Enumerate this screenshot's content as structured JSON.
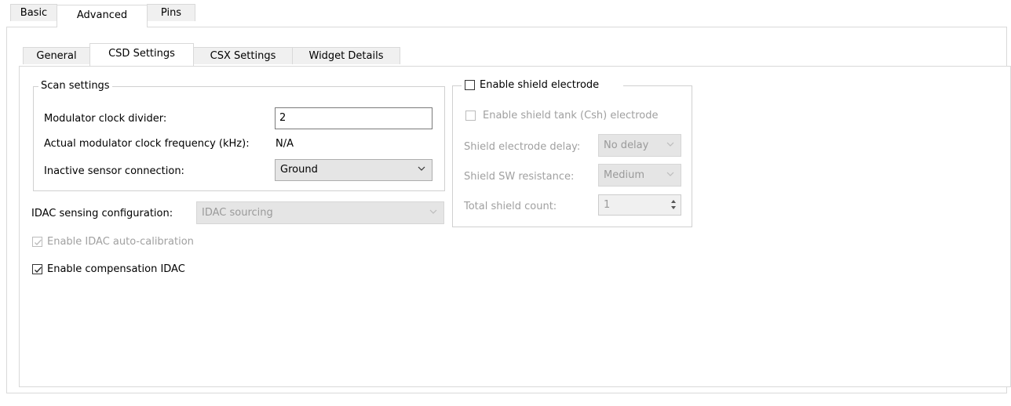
{
  "top_tabs": [
    {
      "label": "Basic",
      "active": false
    },
    {
      "label": "Advanced",
      "active": true
    },
    {
      "label": "Pins",
      "active": false
    }
  ],
  "sub_tabs": [
    {
      "label": "General",
      "active": false
    },
    {
      "label": "CSD Settings",
      "active": true
    },
    {
      "label": "CSX Settings",
      "active": false
    },
    {
      "label": "Widget Details",
      "active": false
    }
  ],
  "scan_settings": {
    "title": "Scan settings",
    "modulator_clock_divider_label": "Modulator clock divider:",
    "modulator_clock_divider_value": "2",
    "actual_freq_label": "Actual modulator clock frequency (kHz):",
    "actual_freq_value": "N/A",
    "inactive_sensor_label": "Inactive sensor connection:",
    "inactive_sensor_value": "Ground"
  },
  "idac": {
    "sensing_config_label": "IDAC sensing configuration:",
    "sensing_config_value": "IDAC sourcing",
    "auto_calibration_label": "Enable IDAC auto-calibration",
    "auto_calibration_checked": true,
    "compensation_label": "Enable compensation IDAC",
    "compensation_checked": true
  },
  "shield": {
    "enable_label": "Enable shield electrode",
    "enable_checked": false,
    "tank_label": "Enable shield tank (Csh) electrode",
    "tank_checked": false,
    "delay_label": "Shield electrode delay:",
    "delay_value": "No delay",
    "sw_resistance_label": "Shield SW resistance:",
    "sw_resistance_value": "Medium",
    "total_count_label": "Total shield count:",
    "total_count_value": "1"
  },
  "colors": {
    "border": "#d9d9d9",
    "disabled_text": "#a0a0a0",
    "combo_bg": "#e5e5e5"
  }
}
